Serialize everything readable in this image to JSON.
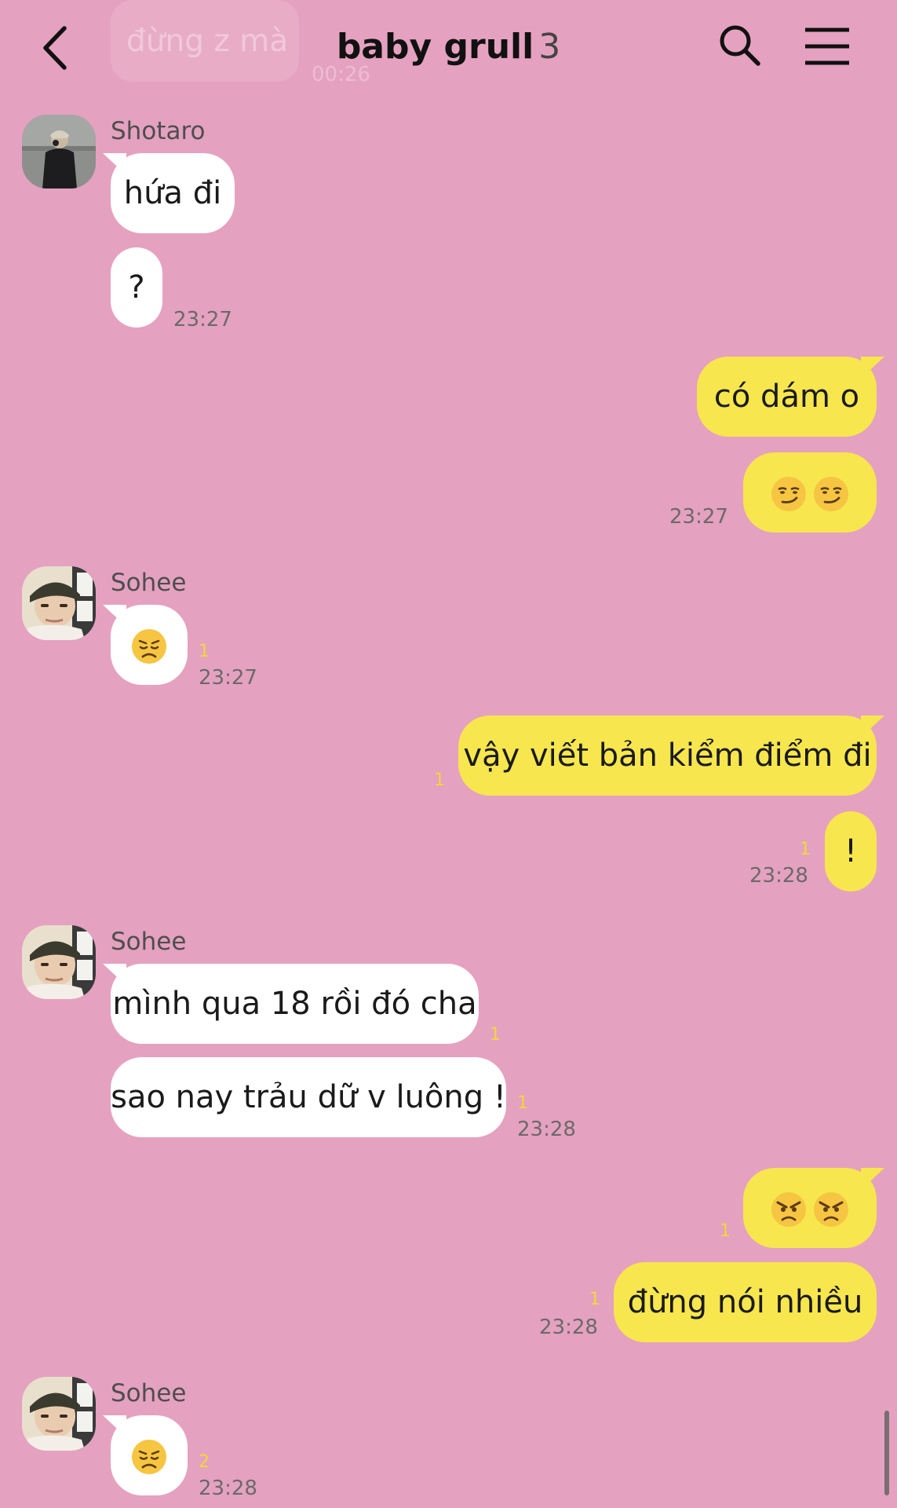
{
  "header": {
    "title": "baby grull",
    "member_count": "3",
    "back_icon": "chevron-left-icon",
    "search_icon": "search-icon",
    "menu_icon": "hamburger-menu-icon"
  },
  "faded_top_message": {
    "text": "đừng z mà",
    "time": "00:26"
  },
  "colors": {
    "background": "#e5a1c0",
    "incoming_bubble": "#ffffff",
    "outgoing_bubble": "#f7e64e",
    "unread_count": "#f2d73a"
  },
  "messages": [
    {
      "sender": "Shotaro",
      "text": "hứa đi",
      "direction": "in"
    },
    {
      "text": "?",
      "direction": "in",
      "time": "23:27"
    },
    {
      "text": "có dám o",
      "direction": "out"
    },
    {
      "emoji": [
        "smirking-face",
        "smirking-face"
      ],
      "direction": "out",
      "time": "23:27"
    },
    {
      "sender": "Sohee",
      "emoji": [
        "disappointed-face"
      ],
      "direction": "in",
      "unread": "1",
      "time": "23:27"
    },
    {
      "text": "vậy viết bản kiểm điểm đi",
      "direction": "out",
      "unread": "1"
    },
    {
      "text": "!",
      "direction": "out",
      "unread": "1",
      "time": "23:28"
    },
    {
      "sender": "Sohee",
      "text": "mình qua 18 rồi đó cha",
      "direction": "in",
      "unread": "1"
    },
    {
      "text": "sao nay trảu dữ v luông !",
      "direction": "in",
      "unread": "1",
      "time": "23:28"
    },
    {
      "emoji": [
        "angry-face",
        "angry-face"
      ],
      "direction": "out",
      "unread": "1"
    },
    {
      "text": "đừng nói nhiều",
      "direction": "out",
      "unread": "1",
      "time": "23:28"
    },
    {
      "sender": "Sohee",
      "emoji": [
        "disappointed-face"
      ],
      "direction": "in",
      "unread": "2",
      "time": "23:28"
    }
  ]
}
